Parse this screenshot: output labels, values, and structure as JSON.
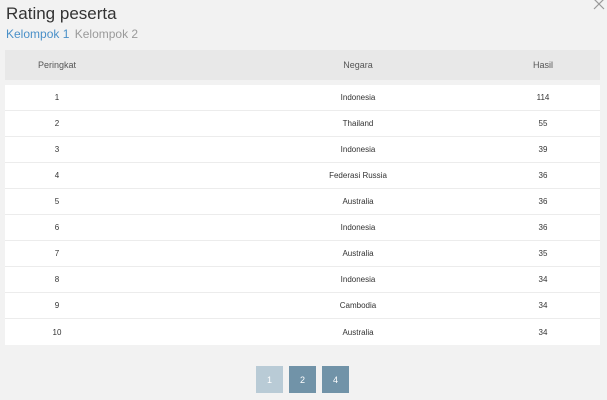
{
  "modal": {
    "title": "Rating peserta"
  },
  "tabs": [
    {
      "label": "Kelompok 1"
    },
    {
      "label": "Kelompok 2"
    }
  ],
  "table": {
    "headers": [
      "Peringkat",
      "Negara",
      "Hasil"
    ],
    "rows": [
      {
        "rank": "1",
        "country": "Indonesia",
        "score": "114"
      },
      {
        "rank": "2",
        "country": "Thailand",
        "score": "55"
      },
      {
        "rank": "3",
        "country": "Indonesia",
        "score": "39"
      },
      {
        "rank": "4",
        "country": "Federasi Russia",
        "score": "36"
      },
      {
        "rank": "5",
        "country": "Australia",
        "score": "36"
      },
      {
        "rank": "6",
        "country": "Indonesia",
        "score": "36"
      },
      {
        "rank": "7",
        "country": "Australia",
        "score": "35"
      },
      {
        "rank": "8",
        "country": "Indonesia",
        "score": "34"
      },
      {
        "rank": "9",
        "country": "Cambodia",
        "score": "34"
      },
      {
        "rank": "10",
        "country": "Australia",
        "score": "34"
      }
    ]
  },
  "pagination": {
    "pages": [
      "1",
      "2",
      "4"
    ]
  },
  "colors": {
    "active_tab": "#4a90c8",
    "page_current": "#b9cbd6",
    "page_normal": "#7193a8"
  }
}
